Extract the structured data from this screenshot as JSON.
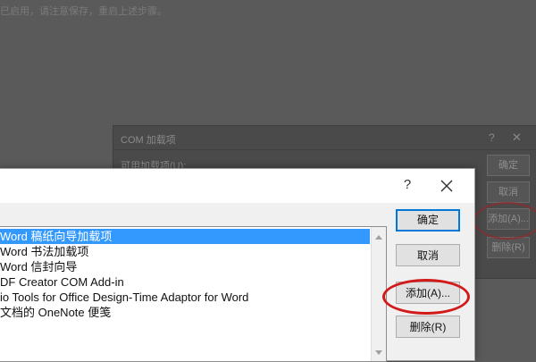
{
  "background": {
    "hint_text": "已启用，请注意保存，重启上述步骤。",
    "dialog_title": "COM 加载项",
    "list_label": "可用加载项(U):",
    "buttons": [
      "确定",
      "取消",
      "添加(A)...",
      "删除(R)"
    ],
    "help": "?",
    "close": "✕"
  },
  "dialog": {
    "help": "?",
    "close_label": "✕",
    "items": [
      {
        "label": "Word 稿纸向导加载项",
        "selected": true
      },
      {
        "label": "Word 书法加载项",
        "selected": false
      },
      {
        "label": "Word 信封向导",
        "selected": false
      },
      {
        "label": "DF Creator COM Add-in",
        "selected": false
      },
      {
        "label": "io Tools for Office Design-Time Adaptor for Word",
        "selected": false
      },
      {
        "label": "文档的 OneNote 便笺",
        "selected": false
      }
    ],
    "buttons": {
      "ok": "确定",
      "cancel": "取消",
      "add": "添加(A)...",
      "remove": "删除(R)"
    }
  },
  "colors": {
    "selection": "#3399ff",
    "default_button_border": "#0078d7",
    "annotation_circle": "#d11a1a"
  }
}
